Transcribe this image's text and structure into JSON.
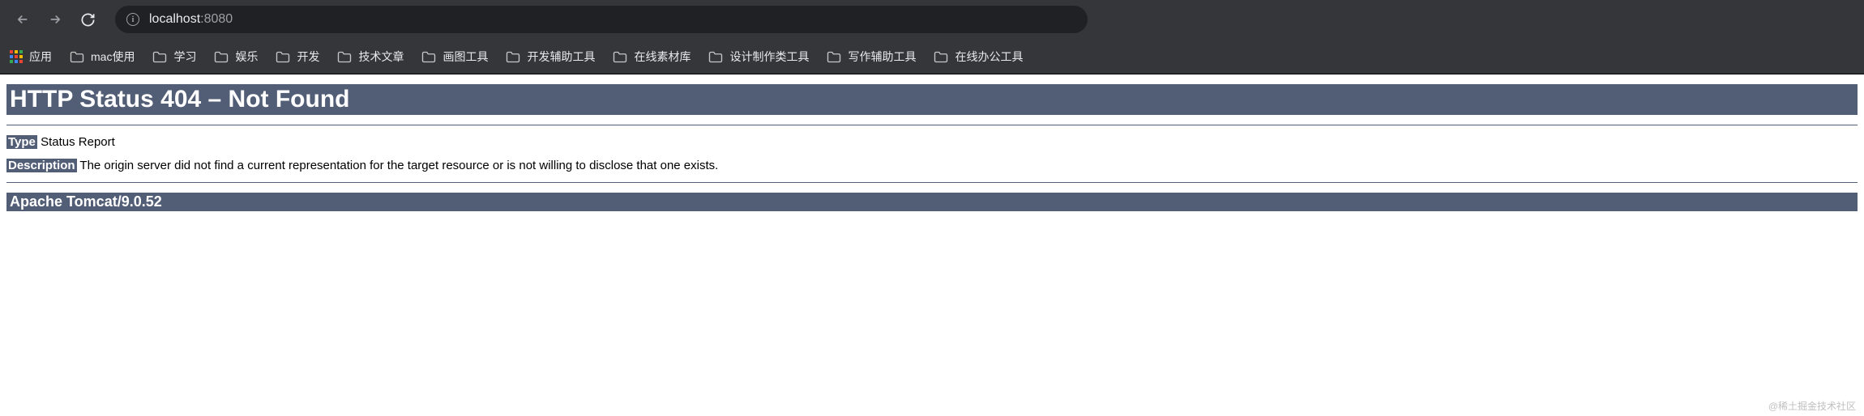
{
  "browser": {
    "url_host": "localhost",
    "url_port": ":8080"
  },
  "bookmarks": {
    "apps_label": "应用",
    "apps_colors": [
      "#ea4335",
      "#fbbc04",
      "#34a853",
      "#4285f4",
      "#ea4335",
      "#fbbc04",
      "#34a853",
      "#4285f4",
      "#ea4335"
    ],
    "items": [
      {
        "label": "mac使用"
      },
      {
        "label": "学习"
      },
      {
        "label": "娱乐"
      },
      {
        "label": "开发"
      },
      {
        "label": "技术文章"
      },
      {
        "label": "画图工具"
      },
      {
        "label": "开发辅助工具"
      },
      {
        "label": "在线素材库"
      },
      {
        "label": "设计制作类工具"
      },
      {
        "label": "写作辅助工具"
      },
      {
        "label": "在线办公工具"
      }
    ]
  },
  "error": {
    "title": "HTTP Status 404 – Not Found",
    "type_label": "Type",
    "type_value": " Status Report",
    "description_label": "Description",
    "description_value": " The origin server did not find a current representation for the target resource or is not willing to disclose that one exists.",
    "server": "Apache Tomcat/9.0.52"
  },
  "watermark": "@稀土掘金技术社区"
}
